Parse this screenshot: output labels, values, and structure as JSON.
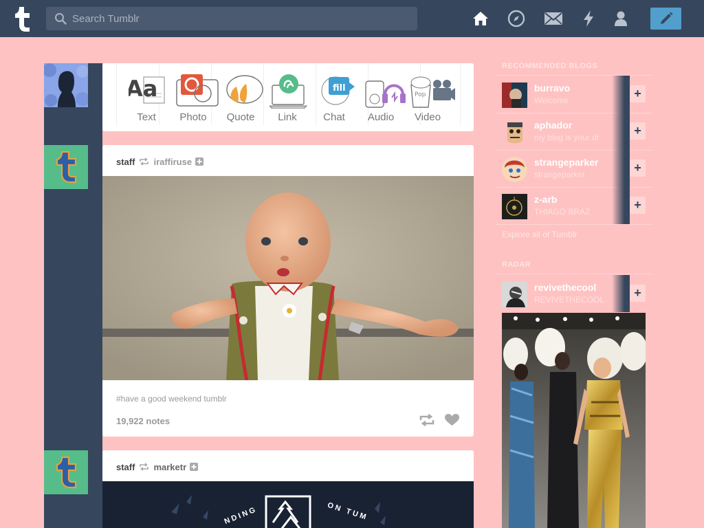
{
  "topbar": {
    "search_placeholder": "Search Tumblr",
    "nav": [
      "home-icon",
      "explore-compass-icon",
      "messages-envelope-icon",
      "activity-lightning-icon",
      "account-person-icon"
    ],
    "compose_icon": "pencil-icon",
    "accent": "#529ecc",
    "bar_color": "#36465d"
  },
  "post_types": [
    {
      "label": "Text",
      "icon": "text-aa-icon"
    },
    {
      "label": "Photo",
      "icon": "camera-icon"
    },
    {
      "label": "Quote",
      "icon": "quote-hands-icon"
    },
    {
      "label": "Link",
      "icon": "link-laptop-icon"
    },
    {
      "label": "Chat",
      "icon": "chat-bubble-icon"
    },
    {
      "label": "Audio",
      "icon": "headphones-icon"
    },
    {
      "label": "Video",
      "icon": "video-camera-icon"
    }
  ],
  "posts": [
    {
      "author": "staff",
      "source": "iraffiruse",
      "tags": "#have a good weekend tumblr",
      "notes": "19,922 notes"
    },
    {
      "author": "staff",
      "source": "marketr",
      "banner_text_left": "NDING",
      "banner_text_right": "ON TUM"
    }
  ],
  "sidebar": {
    "recommended_title": "RECOMMENDED BLOGS",
    "blogs": [
      {
        "name": "burravo",
        "title": "Welcome"
      },
      {
        "name": "aphador",
        "title": "my blog is your dr"
      },
      {
        "name": "strangeparker",
        "title": "strangeparker"
      },
      {
        "name": "z-arb",
        "title": "THIAGO BRAZ"
      }
    ],
    "explore_link": "Explore all of Tumblr",
    "radar_title": "RADAR",
    "radar_blog": {
      "name": "revivethecool",
      "title": "REVIVETHECOOL"
    },
    "follow_symbol": "+"
  }
}
